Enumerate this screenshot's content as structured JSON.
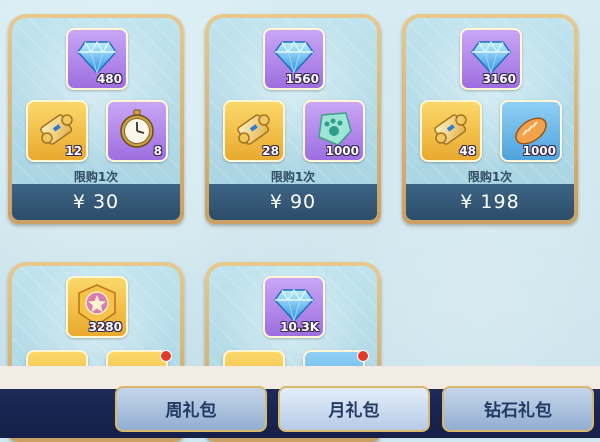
{
  "cards": [
    {
      "limit": "限购1次",
      "price": "¥ 30",
      "items": [
        {
          "icon": "diamond-icon",
          "qty": "480",
          "bg": "purple"
        },
        {
          "icon": "scroll-icon",
          "qty": "12",
          "bg": "gold"
        },
        {
          "icon": "pocket-watch-icon",
          "qty": "8",
          "bg": "purple"
        }
      ]
    },
    {
      "limit": "限购1次",
      "price": "¥ 90",
      "items": [
        {
          "icon": "diamond-icon",
          "qty": "1560",
          "bg": "purple"
        },
        {
          "icon": "scroll-icon",
          "qty": "28",
          "bg": "gold"
        },
        {
          "icon": "paw-crystal-icon",
          "qty": "1000",
          "bg": "purple"
        }
      ]
    },
    {
      "limit": "限购1次",
      "price": "¥ 198",
      "items": [
        {
          "icon": "diamond-icon",
          "qty": "3160",
          "bg": "purple"
        },
        {
          "icon": "scroll-icon",
          "qty": "48",
          "bg": "gold"
        },
        {
          "icon": "bread-icon",
          "qty": "1000",
          "bg": "blue"
        }
      ]
    },
    {
      "items": [
        {
          "icon": "star-badge-icon",
          "qty": "3280",
          "bg": "gold"
        }
      ]
    },
    {
      "items": [
        {
          "icon": "diamond-icon",
          "qty": "10.3K",
          "bg": "purple"
        }
      ]
    }
  ],
  "nav": {
    "tabs": [
      {
        "label": "周礼包",
        "active": false
      },
      {
        "label": "月礼包",
        "active": true
      },
      {
        "label": "钻石礼包",
        "active": false
      }
    ]
  },
  "colors": {
    "price_bar": "#2c4d6a",
    "card_border": "#caa064",
    "nav_bg": "#1e2a58"
  }
}
